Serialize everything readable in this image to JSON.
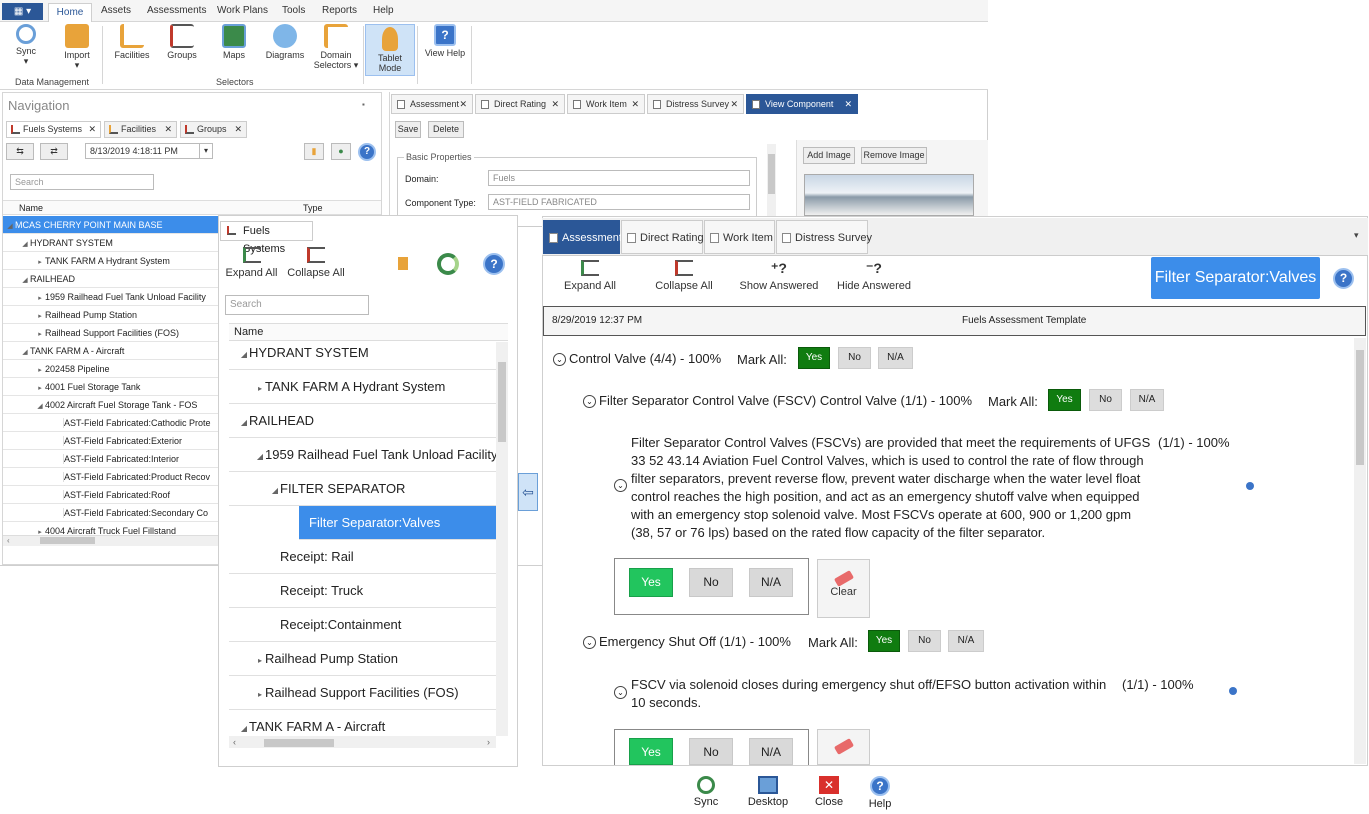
{
  "menubar": {
    "items": [
      "Home",
      "Assets",
      "Assessments",
      "Work Plans",
      "Tools",
      "Reports",
      "Help"
    ]
  },
  "ribbon": {
    "buttons": [
      {
        "label": "Sync",
        "icon": "sync-icon"
      },
      {
        "label": "Import",
        "icon": "import-icon"
      },
      {
        "label": "Facilities",
        "icon": "facilities-icon"
      },
      {
        "label": "Groups",
        "icon": "groups-icon"
      },
      {
        "label": "Maps",
        "icon": "maps-icon"
      },
      {
        "label": "Diagrams",
        "icon": "diagrams-icon"
      },
      {
        "label": "Domain Selectors",
        "icon": "domain-selectors-icon"
      },
      {
        "label": "Tablet Mode",
        "icon": "tablet-mode-icon"
      },
      {
        "label": "View Help",
        "icon": "help-icon"
      }
    ],
    "groups": [
      "Data Management",
      "Selectors"
    ]
  },
  "navigation": {
    "title": "Navigation",
    "pin": "📌",
    "tabs": [
      "Fuels Systems",
      "Facilities",
      "Groups"
    ],
    "date": "8/13/2019 4:18:11 PM",
    "search_placeholder": "Search",
    "columns": [
      "Name",
      "Type"
    ],
    "rows": [
      {
        "label": "MCAS CHERRY POINT MAIN BASE",
        "level": 0,
        "expanded": true,
        "selected": true
      },
      {
        "label": "HYDRANT SYSTEM",
        "level": 1,
        "expanded": true
      },
      {
        "label": "TANK FARM A Hydrant System",
        "level": 2,
        "expanded": false
      },
      {
        "label": "RAILHEAD",
        "level": 1,
        "expanded": true
      },
      {
        "label": "1959 Railhead Fuel Tank Unload Facility",
        "level": 2,
        "expanded": false
      },
      {
        "label": "Railhead Pump Station",
        "level": 2,
        "expanded": false
      },
      {
        "label": "Railhead Support Facilities (FOS)",
        "level": 2,
        "expanded": false
      },
      {
        "label": "TANK FARM A - Aircraft",
        "level": 1,
        "expanded": true
      },
      {
        "label": "202458 Pipeline",
        "level": 2,
        "expanded": false
      },
      {
        "label": "4001 Fuel Storage Tank",
        "level": 2,
        "expanded": false
      },
      {
        "label": "4002 Aircraft Fuel Storage Tank - FOS",
        "level": 2,
        "expanded": true
      },
      {
        "label": "AST-Field Fabricated:Cathodic Prote",
        "level": 3
      },
      {
        "label": "AST-Field Fabricated:Exterior",
        "level": 3
      },
      {
        "label": "AST-Field Fabricated:Interior",
        "level": 3
      },
      {
        "label": "AST-Field Fabricated:Product Recov",
        "level": 3
      },
      {
        "label": "AST-Field Fabricated:Roof",
        "level": 3
      },
      {
        "label": "AST-Field Fabricated:Secondary Co",
        "level": 3
      },
      {
        "label": "4004 Aircraft Truck Fuel Fillstand",
        "level": 2,
        "expanded": false
      }
    ]
  },
  "desktop_tabs": [
    "Assessment",
    "Direct Rating",
    "Work Item",
    "Distress Survey",
    "View Component"
  ],
  "component": {
    "save": "Save",
    "delete": "Delete",
    "section": "Basic Properties",
    "domain_label": "Domain:",
    "domain_value": "Fuels",
    "type_label": "Component Type:",
    "type_value": "AST-FIELD FABRICATED",
    "add_image": "Add Image",
    "remove_image": "Remove Image"
  },
  "tablet_nav": {
    "tab": "Fuels Systems",
    "expand_all": "Expand All",
    "collapse_all": "Collapse All",
    "search_placeholder": "Search",
    "column": "Name",
    "rows": [
      {
        "label": "HYDRANT SYSTEM",
        "level": 0,
        "expanded": true
      },
      {
        "label": "TANK FARM A Hydrant System",
        "level": 1,
        "expanded": false
      },
      {
        "label": "RAILHEAD",
        "level": 0,
        "expanded": true
      },
      {
        "label": "1959 Railhead Fuel Tank Unload Facility",
        "level": 1,
        "expanded": true
      },
      {
        "label": "FILTER SEPARATOR",
        "level": 2,
        "expanded": true
      },
      {
        "label": "Filter Separator:Valves",
        "level": 3,
        "selected": true
      },
      {
        "label": "Receipt: Rail",
        "level": 2
      },
      {
        "label": "Receipt: Truck",
        "level": 2
      },
      {
        "label": "Receipt:Containment",
        "level": 2
      },
      {
        "label": "Railhead Pump Station",
        "level": 1,
        "expanded": false
      },
      {
        "label": "Railhead Support Facilities (FOS)",
        "level": 1,
        "expanded": false
      },
      {
        "label": "TANK FARM A - Aircraft",
        "level": 0,
        "expanded": true
      }
    ]
  },
  "tablet_main": {
    "tabs": [
      "Assessment",
      "Direct Rating",
      "Work Item",
      "Distress Survey"
    ],
    "tools": [
      "Expand All",
      "Collapse All",
      "Show Answered",
      "Hide Answered"
    ],
    "badge": "Filter Separator:Valves",
    "date": "8/29/2019 12:37 PM",
    "template": "Fuels Assessment Template",
    "mark_all": "Mark All:",
    "yes": "Yes",
    "no": "No",
    "na": "N/A",
    "clear": "Clear",
    "q1": "Control Valve (4/4) - 100%",
    "q1a": "Filter Separator Control Valve (FSCV) Control Valve (1/1) - 100%",
    "q1a_text": "Filter Separator Control Valves (FSCVs) are provided that meet the requirements of UFGS 33 52 43.14 Aviation Fuel Control Valves, which is used to control the rate of flow through filter separators, prevent reverse flow, prevent water discharge when the water level float control reaches the high position, and act as an emergency shutoff valve when equipped with an emergency stop solenoid valve. Most FSCVs operate at 600, 900 or 1,200 gpm (38, 57 or 76 lps) based on the rated flow capacity of the filter separator.",
    "q1a_score": "(1/1) - 100%",
    "q2": "Emergency Shut Off (1/1) - 100%",
    "q2_text": "FSCV via solenoid closes during emergency shut off/EFSO button activation within 10 seconds.",
    "q2_score": "(1/1) - 100%"
  },
  "bottom_bar": [
    "Sync",
    "Desktop",
    "Close",
    "Help"
  ]
}
